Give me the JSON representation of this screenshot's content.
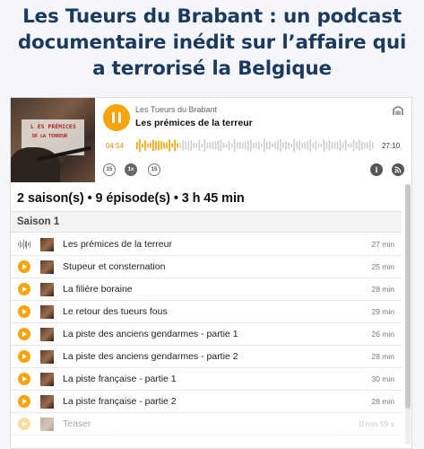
{
  "headline": {
    "line1": "Les Tueurs du Brabant : un podcast",
    "line2": "documentaire inédit sur l’affaire qui",
    "line3": "a terrorisé la Belgique"
  },
  "player": {
    "cover": {
      "line1": "L ES PRÉMICES",
      "line2": "DE LA TERREUR"
    },
    "show_name": "Les Tueurs du Brabant",
    "episode_title": "Les prémices de la terreur",
    "current_time": "04:54",
    "total_time": "27:10",
    "progress_fraction": 0.18,
    "controls": {
      "rewind": "15",
      "speed": "1x",
      "forward": "15"
    },
    "info_label": "i"
  },
  "summary": "2 saison(s) • 9 épisode(s) • 3 h 45 min",
  "season": "Saison 1",
  "episodes": [
    {
      "title": "Les prémices de la terreur",
      "duration": "27 min",
      "state": "playing"
    },
    {
      "title": "Stupeur et consternation",
      "duration": "25 min",
      "state": "idle"
    },
    {
      "title": "La filière boraine",
      "duration": "28 min",
      "state": "idle"
    },
    {
      "title": "Le retour des tueurs fous",
      "duration": "29 min",
      "state": "idle"
    },
    {
      "title": "La piste des anciens gendarmes - partie 1",
      "duration": "26 min",
      "state": "idle"
    },
    {
      "title": "La piste des anciens gendarmes - partie 2",
      "duration": "28 min",
      "state": "idle"
    },
    {
      "title": "La piste française - partie 1",
      "duration": "30 min",
      "state": "idle"
    },
    {
      "title": "La piste française - partie 2",
      "duration": "28 min",
      "state": "idle"
    },
    {
      "title": "Teaser",
      "duration": "0 min 59 s",
      "state": "idle"
    }
  ],
  "colors": {
    "accent": "#f5a40c",
    "headline": "#1c3a5e"
  }
}
